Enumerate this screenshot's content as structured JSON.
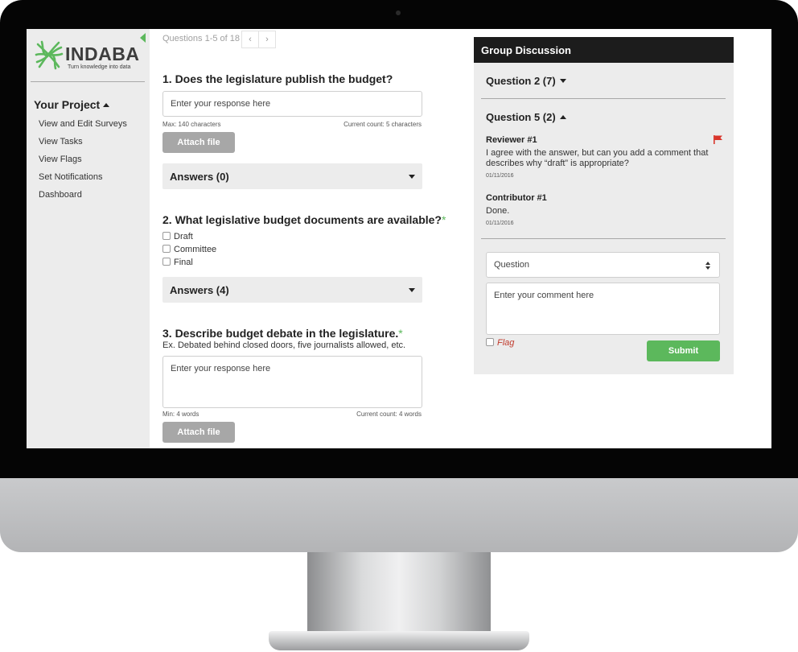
{
  "brand": {
    "name": "INDABA",
    "tagline": "Turn knowledge into data",
    "logo_icon": "indaba-logo-icon",
    "accent_color": "#5cb85c"
  },
  "sidebar": {
    "project_title": "Your Project",
    "items": [
      {
        "label": "View and Edit Surveys"
      },
      {
        "label": "View Tasks"
      },
      {
        "label": "View Flags"
      },
      {
        "label": "Set Notifications"
      },
      {
        "label": "Dashboard"
      }
    ]
  },
  "pager": {
    "text": "Questions 1-5 of 18",
    "prev": "‹",
    "next": "›"
  },
  "questions": [
    {
      "title": "1. Does the legislature publish the budget?",
      "input_value": "Enter your response here",
      "meta_left": "Max: 140 characters",
      "meta_right": "Current count: 5 characters",
      "attach_label": "Attach file",
      "answers_label": "Answers (0)"
    },
    {
      "title": "2. What legislative budget documents are available?",
      "required_mark": "*",
      "options": [
        {
          "label": "Draft"
        },
        {
          "label": "Committee"
        },
        {
          "label": "Final"
        }
      ],
      "answers_label": "Answers (4)"
    },
    {
      "title": "3. Describe budget debate in the legislature.",
      "required_mark": "*",
      "help": "Ex. Debated behind closed doors, five journalists allowed, etc.",
      "input_value": "Enter your response here",
      "meta_left": "Min: 4 words",
      "meta_right": "Current count: 4 words",
      "attach_label": "Attach file"
    }
  ],
  "discussion": {
    "title": "Group Discussion",
    "groups": [
      {
        "label": "Question 2 (7)",
        "expanded": false
      },
      {
        "label": "Question 5 (2)",
        "expanded": true
      }
    ],
    "comments": [
      {
        "author": "Reviewer #1",
        "body": "I agree with the answer, but can you add a comment that describes why “draft” is appropriate?",
        "date": "01/11/2016",
        "flagged": true,
        "flag_color": "#d9352b"
      },
      {
        "author": "Contributor #1",
        "body": "Done.",
        "date": "01/11/2016",
        "flagged": false
      }
    ],
    "select_value": "Question",
    "comment_placeholder": "Enter your comment here",
    "flag_label": "Flag",
    "submit_label": "Submit"
  }
}
